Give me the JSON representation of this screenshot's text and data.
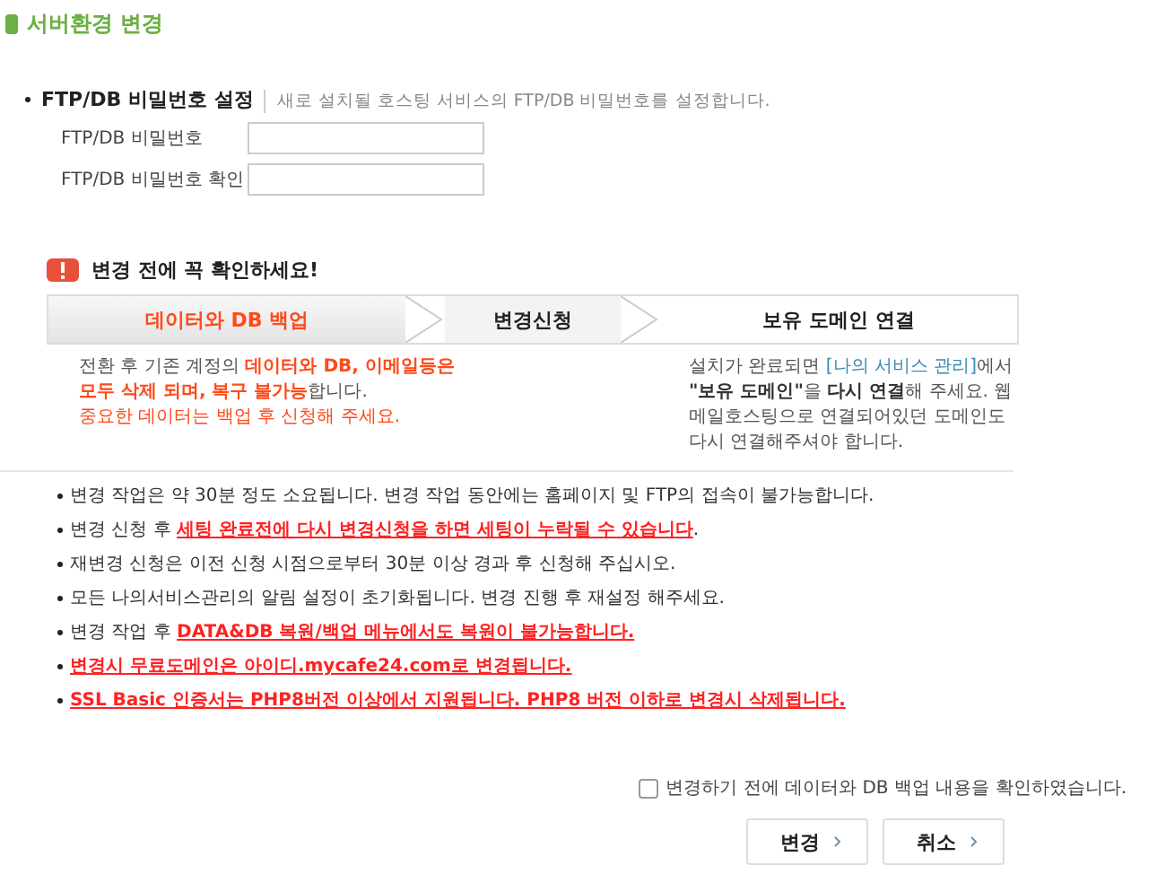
{
  "page_title": "서버환경 변경",
  "password_section": {
    "title": "FTP/DB 비밀번호 설정",
    "description": "새로 설치될 호스팅 서비스의 FTP/DB 비밀번호를 설정합니다.",
    "fields": [
      {
        "label": "FTP/DB 비밀번호"
      },
      {
        "label": "FTP/DB 비밀번호 확인"
      }
    ]
  },
  "warning": {
    "title": "변경 전에 꼭 확인하세요!"
  },
  "steps": [
    {
      "label": "데이터와 DB 백업",
      "selected": true
    },
    {
      "label": "변경신청",
      "selected": false
    },
    {
      "label": "보유 도메인 연결",
      "selected": false
    }
  ],
  "backup_note": {
    "text": "전환 후 기존 계정의 **데이터와 DB, 이메일등은 모두 삭제 되며, 복구 불가능**합니다.",
    "hint": "중요한 데이터는 백업 후 신청해 주세요."
  },
  "domain_note": {
    "before": "설치가 완료되면 ",
    "link": "[나의 서비스 관리]",
    "after": "에서 **\"보유 도메인\"**을 **다시 연결**해 주세요. 웹메일호스팅으로 연결되어있던 도메인도 다시 연결해주셔야 합니다."
  },
  "notices": [
    {
      "kind": "normal",
      "text": "변경 작업은 약 30분 정도 소요됩니다. 변경 작업 동안에는 홈페이지 및 FTP의 접속이 불가능합니다."
    },
    {
      "kind": "normal",
      "text": "변경 신청 후 **세팅 완료전에 다시 변경신청을 하면 세팅이 누락될 수 있습니다**."
    },
    {
      "kind": "normal",
      "text": "재변경 신청은 이전 신청 시점으로부터 30분 이상 경과 후 신청해 주십시오."
    },
    {
      "kind": "normal",
      "text": "모든 나의서비스관리의 알림 설정이 초기화됩니다. 변경 진행 후 재설정 해주세요."
    },
    {
      "kind": "normal",
      "text": "변경 작업 후 **DATA&DB 복원/백업 메뉴에서도 복원이 불가능합니다.**"
    },
    {
      "kind": "alert",
      "text": "변경시 무료도메인은 아이디.mycafe24.com로 변경됩니다."
    },
    {
      "kind": "alert",
      "text": "SSL Basic 인증서는 PHP8버전 이상에서 지원됩니다. PHP8 버전 이하로 변경시 삭제됩니다."
    }
  ],
  "confirm": {
    "label": "변경하기 전에 데이터와 DB 백업 내용을 확인하였습니다.",
    "checked": false
  },
  "buttons": [
    {
      "label": "변경"
    },
    {
      "label": "취소"
    }
  ]
}
